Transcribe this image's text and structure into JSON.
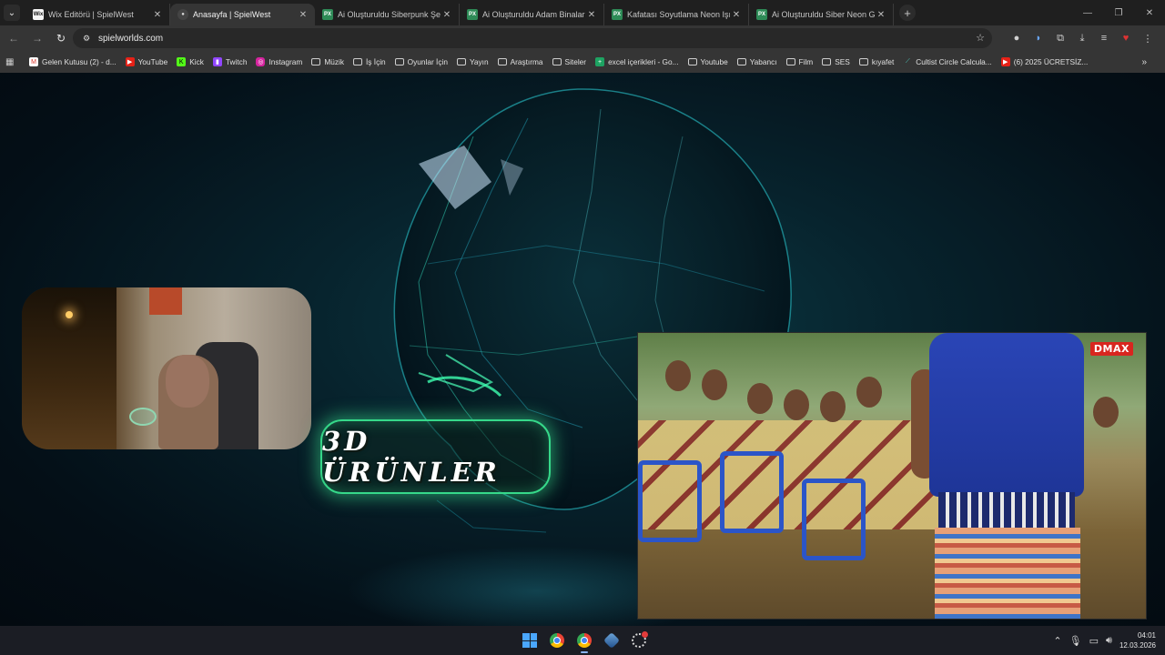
{
  "browser": {
    "tabs": [
      {
        "label": "Wix Editörü | SpielWest",
        "favicon": "wix-icon",
        "active": false
      },
      {
        "label": "Anasayfa | SpielWest",
        "favicon": "spielwest-icon",
        "active": true
      },
      {
        "label": "Ai Oluşturuldu Siberpunk Şehir",
        "favicon": "px-icon",
        "active": false
      },
      {
        "label": "Ai Oluşturuldu Adam Binalar - ",
        "favicon": "px-icon",
        "active": false
      },
      {
        "label": "Kafatası Soyutlama Neon Işık",
        "favicon": "px-icon",
        "active": false
      },
      {
        "label": "Ai Oluşturuldu Siber Neon Gec",
        "favicon": "px-icon",
        "active": false
      }
    ],
    "url": "spielworlds.com",
    "bookmarks": [
      {
        "label": "Gelen Kutusu (2) - d...",
        "icon": "gmail-icon"
      },
      {
        "label": "YouTube",
        "icon": "youtube-icon"
      },
      {
        "label": "Kick",
        "icon": "kick-icon"
      },
      {
        "label": "Twitch",
        "icon": "twitch-icon"
      },
      {
        "label": "Instagram",
        "icon": "instagram-icon"
      },
      {
        "label": "Müzik",
        "icon": "folder-icon"
      },
      {
        "label": "İş İçin",
        "icon": "folder-icon"
      },
      {
        "label": "Oyunlar İçin",
        "icon": "folder-icon"
      },
      {
        "label": "Yayın",
        "icon": "folder-icon"
      },
      {
        "label": "Araştırma",
        "icon": "folder-icon"
      },
      {
        "label": "Siteler",
        "icon": "folder-icon"
      },
      {
        "label": "excel içerikleri - Go...",
        "icon": "sheets-icon"
      },
      {
        "label": "Youtube",
        "icon": "folder-icon"
      },
      {
        "label": "Yabancı",
        "icon": "folder-icon"
      },
      {
        "label": "Film",
        "icon": "folder-icon"
      },
      {
        "label": "SES",
        "icon": "folder-icon"
      },
      {
        "label": "kıyafet",
        "icon": "folder-icon"
      },
      {
        "label": "Cultist Circle Calcula...",
        "icon": "cultist-icon"
      },
      {
        "label": "(6) 2025 ÜCRETSİZ...",
        "icon": "youtube-icon"
      }
    ]
  },
  "page": {
    "badge_text": "3D ÜRÜNLER",
    "video_channel_logo": "DMAX"
  },
  "taskbar": {
    "time": "04:01",
    "date": "12.03.2026"
  },
  "colors": {
    "neon_green": "#36d98a",
    "background": "#050d14"
  }
}
